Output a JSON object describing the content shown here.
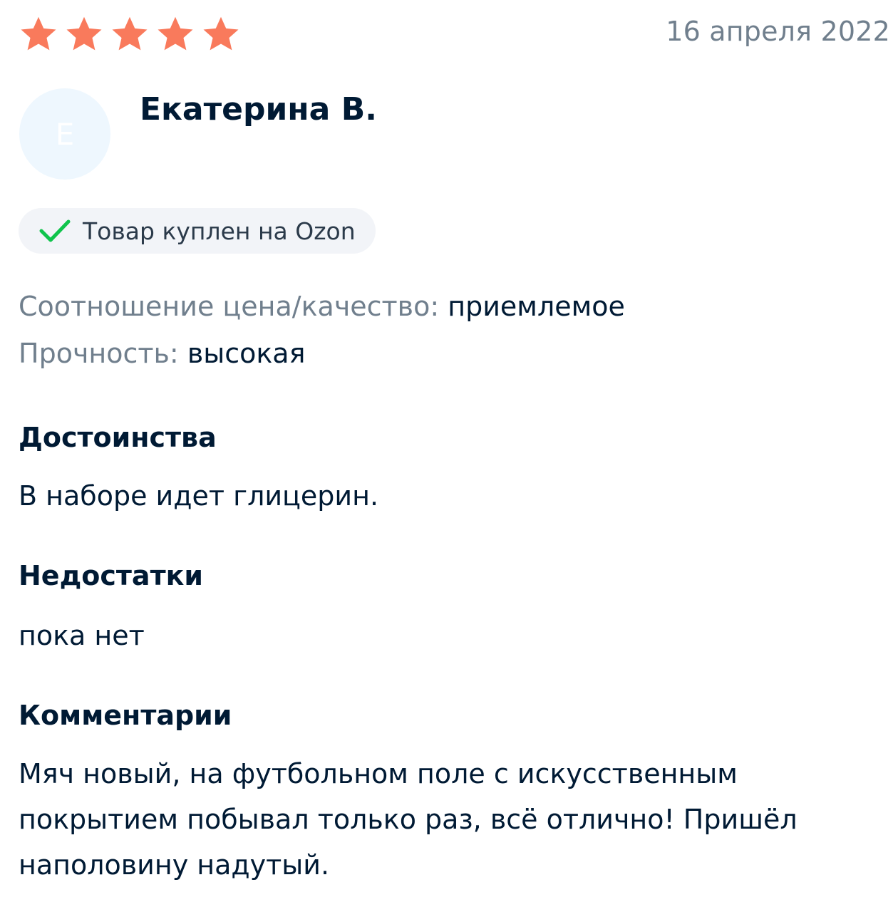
{
  "rating": {
    "value": 5,
    "max": 5,
    "star_color": "#f97a5c",
    "icon": "star-icon"
  },
  "date": "16 апреля 2022",
  "author": {
    "initial": "Е",
    "name": "Екатерина В.",
    "avatar_color": "#eef7fe"
  },
  "purchase_badge": {
    "icon": "check-icon",
    "icon_color": "#10c44c",
    "label": "Товар куплен на Ozon"
  },
  "attributes": [
    {
      "label": "Соотношение цена/качество:",
      "value": "приемлемое"
    },
    {
      "label": "Прочность:",
      "value": "высокая"
    }
  ],
  "pros": {
    "title": "Достоинства",
    "text": "В наборе идет глицерин."
  },
  "cons": {
    "title": "Недостатки",
    "text": "пока нет"
  },
  "comment": {
    "title": "Комментарии",
    "text": "Мяч новый, на футбольном поле с искусственным покрытием побывал только раз, всё отлично! Пришёл наполовину надутый."
  }
}
